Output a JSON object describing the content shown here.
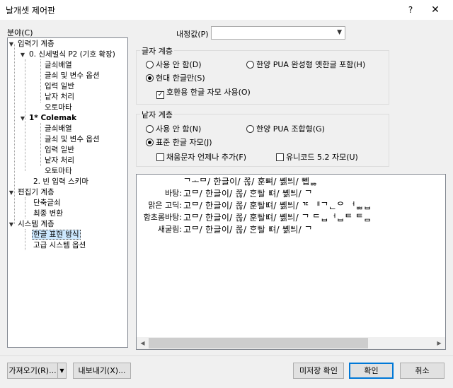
{
  "window": {
    "title": "날개셋 제어판",
    "help": "?",
    "close": "✕"
  },
  "tree": {
    "label": "분야(C)",
    "items": [
      {
        "label": "입력기 계층"
      },
      {
        "label": "0. 신세벌식 P2 (기호 확장)"
      },
      {
        "label": "글쇠배열"
      },
      {
        "label": "글쇠 및 변수 옵션"
      },
      {
        "label": "입력 일반"
      },
      {
        "label": "낱자 처리"
      },
      {
        "label": "오토마타"
      },
      {
        "label": "1* Colemak"
      },
      {
        "label": "글쇠배열"
      },
      {
        "label": "글쇠 및 변수 옵션"
      },
      {
        "label": "입력 일반"
      },
      {
        "label": "낱자 처리"
      },
      {
        "label": "오토마타"
      },
      {
        "label": "2. 빈 입력 스키마"
      },
      {
        "label": "편집기 계층"
      },
      {
        "label": "단축글쇠"
      },
      {
        "label": "최종 변환"
      },
      {
        "label": "시스템 계층"
      },
      {
        "label": "한글 표현 방식"
      },
      {
        "label": "고급 시스템 옵션"
      }
    ]
  },
  "preset": {
    "label": "내정값(P)",
    "value": ""
  },
  "char_group": {
    "title": "글자 계층",
    "opt_none": "사용 안 함(D)",
    "opt_pua": "한양 PUA 완성형 옛한글 포함(H)",
    "opt_modern": "현대 한글만(S)",
    "chk_compat": "호환용 한글 자모 사용(O)",
    "compat_mark": "✓"
  },
  "jamo_group": {
    "title": "낱자 계층",
    "opt_none": "사용 안 함(N)",
    "opt_pua": "한양 PUA 조합형(G)",
    "opt_std": "표준 한글 자모(J)",
    "chk_filler": "채움문자 언제나 추가(F)",
    "chk_unicode": "유니코드 5.2 자모(U)"
  },
  "preview": {
    "rows": [
      {
        "label": "",
        "text": "ᄀᅠᅩᄆ/ 한글이/ ᄙᅩᆭ/ 훈ᄥᅧ/ ᄴᅨᇑᄡᅴ/ ᄤᅦᆸᇥ"
      },
      {
        "label": "바탕:",
        "text": "고ᄆ/ 한글이/ ᄙᅩᆭ/ ᄒᆞᆫᄡᅡᆯ ᄠᅧ/ ᄴᅨᇑᄡᅴ/ ᄀ"
      },
      {
        "label": "맑은 고딕:",
        "text": "고ᄆ/ 한글이/ ᄙᅩᆭ/ 훈ᄡᅡᆯᄠᅧ/ ᄴᅨᇑᄡᅴ/ ᄀᄃ ᅵᅵᄀᆫᄋ ᅥᆸᆸᆸ"
      },
      {
        "label": "함초롬바탕:",
        "text": "고ᄆ/ 한글이/ ᄙᅩᆭ/ 훈ᄡᅡᆯᄠᅧ/ ᄴᅨᇑᄡᅴ/ ᄀ ᄃᆸᅥᆸᄐ ᄐᆷ"
      },
      {
        "label": "새굴림:",
        "text": "고ᄆ/ 한글이/ ᄙᅩᆭ/ ᄒᆞᆫᄡᅡᆯ ᄠᅧ/ ᄴᅨᇑᄡᅴ/ ᄀ"
      }
    ],
    "scroll_left": "◀",
    "scroll_right": "▶"
  },
  "buttons": {
    "import": "가져오기(R)...",
    "import_arrow": "▼",
    "export": "내보내기(X)...",
    "unsaved": "미저장 확인",
    "ok": "확인",
    "cancel": "취소"
  }
}
